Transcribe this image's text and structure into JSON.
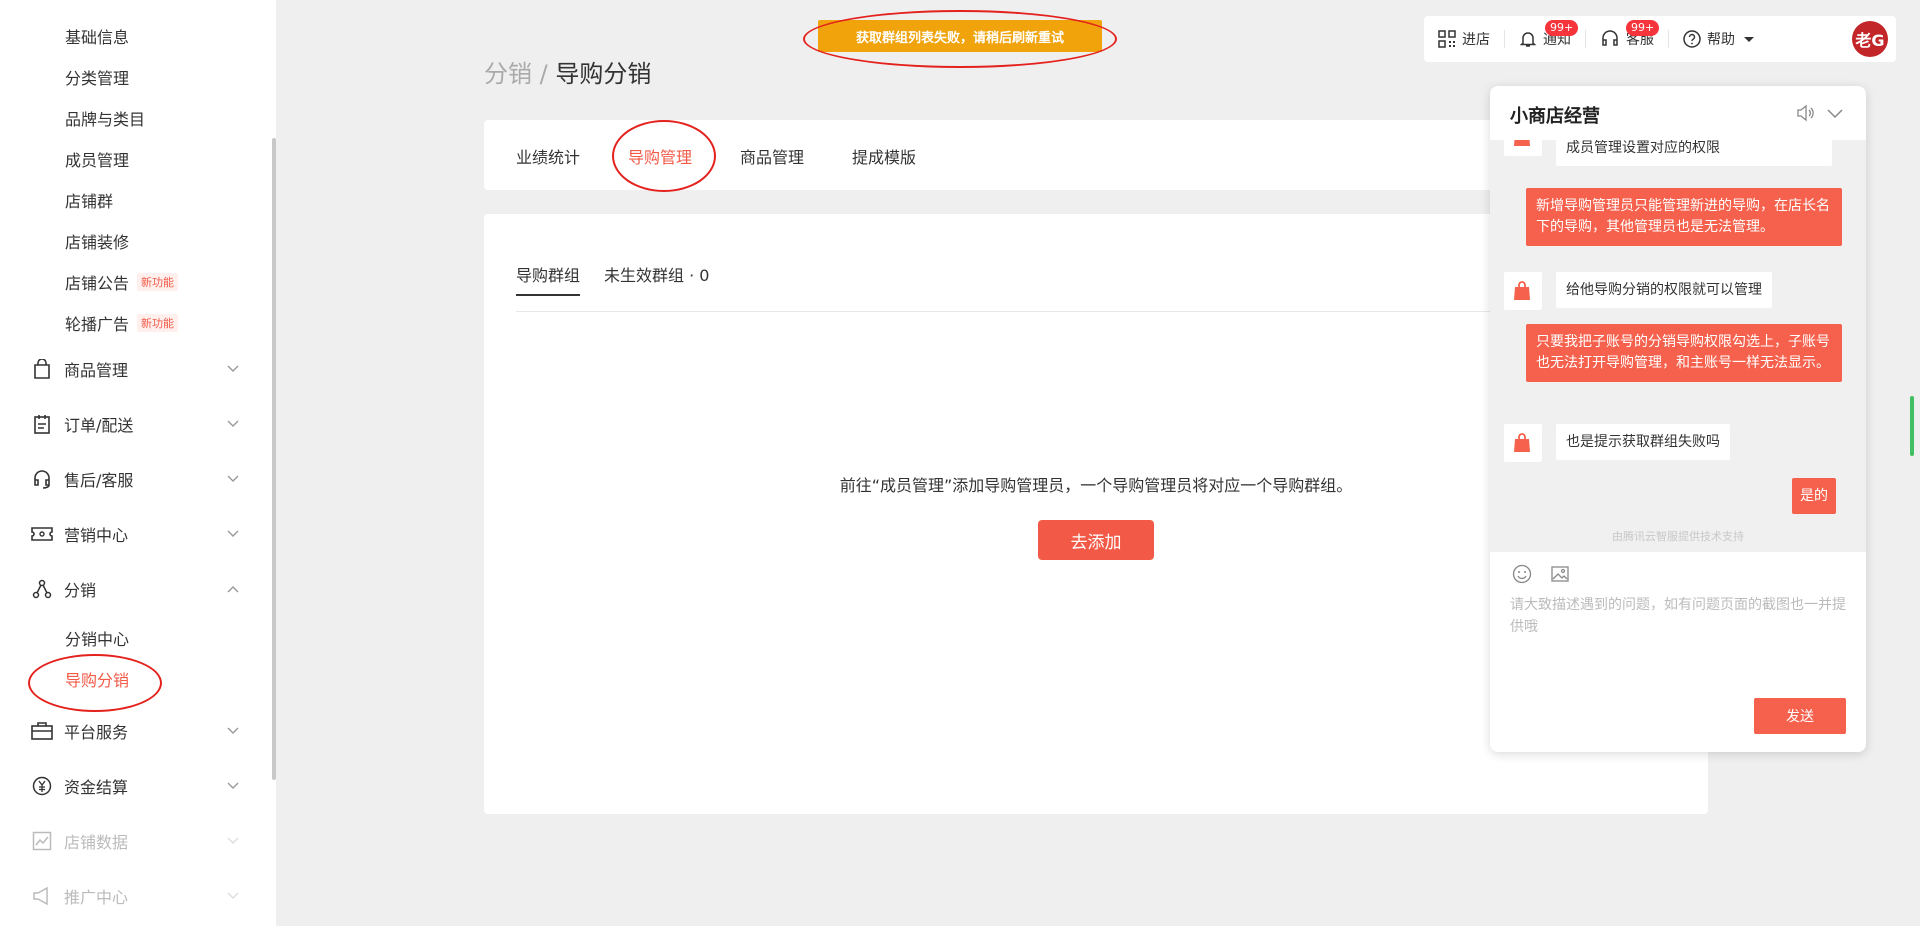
{
  "toast": {
    "message": "获取群组列表失败，请稍后刷新重试"
  },
  "sidebar": {
    "top_items": [
      "基础信息",
      "分类管理",
      "品牌与类目",
      "成员管理",
      "店铺群",
      "店铺装修",
      "店铺公告",
      "轮播广告"
    ],
    "new_badge": "新功能",
    "groups": {
      "goods": "商品管理",
      "orders": "订单/配送",
      "service": "售后/客服",
      "marketing": "营销中心",
      "distribution": "分销",
      "platform": "平台服务",
      "settlement": "资金结算",
      "data": "店铺数据",
      "promo": "推广中心"
    },
    "distribution_items": [
      "分销中心",
      "导购分销"
    ]
  },
  "topbar": {
    "enter_store": "进店",
    "notice": "通知",
    "notice_count": "99+",
    "service": "客服",
    "service_count": "99+",
    "help": "帮助",
    "avatar_text": "老G"
  },
  "breadcrumb": {
    "parent": "分销",
    "separator": "/",
    "current": "导购分销"
  },
  "tabs": [
    "业绩统计",
    "导购管理",
    "商品管理",
    "提成模版"
  ],
  "content": {
    "subtab_groups": "导购群组",
    "subtab_inactive": "未生效群组 · 0",
    "empty_text": "前往“成员管理”添加导购管理员，一个导购管理员将对应一个导购群组。",
    "add_button": "去添加"
  },
  "chat": {
    "title": "小商店经营",
    "messages": {
      "m0": "成员管理设置对应的权限",
      "m1": "新增导购管理员只能管理新进的导购，在店长名下的导购，其他管理员也是无法管理。",
      "m2": "给他导购分销的权限就可以管理",
      "m3": "只要我把子账号的分销导购权限勾选上，子账号也无法打开导购管理，和主账号一样无法显示。",
      "m4": "也是提示获取群组失败吗",
      "m5": "是的"
    },
    "powered_by": "由腾讯云智服提供技术支持",
    "input_placeholder": "请大致描述遇到的问题，如有问题页面的截图也一并提供哦",
    "send_button": "发送"
  },
  "colors": {
    "accent": "#f25a47",
    "toast": "#f0a30a",
    "annotation": "#e4221d"
  }
}
